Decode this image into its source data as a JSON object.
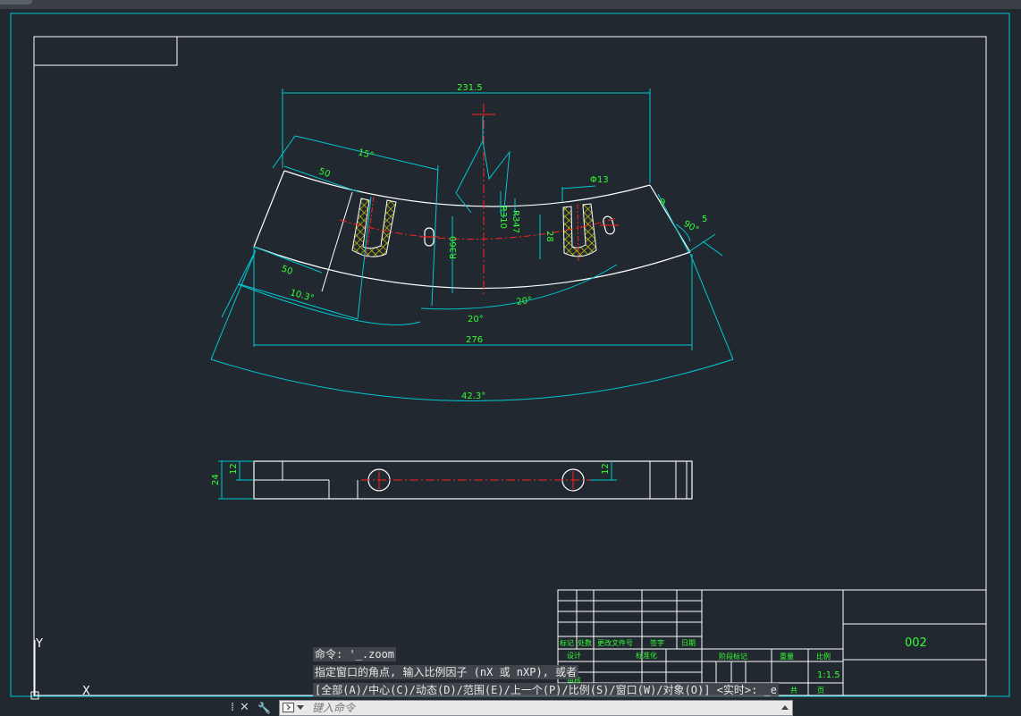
{
  "drawing": {
    "dim_overall_width": "231.5",
    "dim_angle_15": "15°",
    "dim_50_top": "50",
    "dim_50_left": "50",
    "dim_angle_10_3": "10.3°",
    "dim_angle_20_a": "20°",
    "dim_angle_20_b": "20°",
    "dim_276": "276",
    "dim_angle_42_3": "42.3°",
    "dim_r310": "R310",
    "dim_r347": "R347",
    "dim_r360": "R360",
    "dim_phi13": "Φ13",
    "dim_28": "28",
    "dim_9": "9",
    "dim_90deg": "90°",
    "dim_5": "5",
    "dim_24": "24",
    "dim_12_left": "12",
    "dim_12_right": "12"
  },
  "title_block": {
    "drawing_no": "002",
    "scale": "1:1.5",
    "header_row": [
      "标记",
      "处数",
      "更改文件号",
      "签字",
      "日期"
    ],
    "design": "设计",
    "standardize": "标准化",
    "review": "审核",
    "stage_mark": "阶段标记",
    "weight": "重量",
    "ratio": "比例",
    "total": "共",
    "page": "页"
  },
  "ucs": {
    "y_label": "Y",
    "x_label": "X"
  },
  "command": {
    "history": [
      "命令: '_.zoom",
      "指定窗口的角点, 输入比例因子 (nX 或 nXP), 或者",
      "[全部(A)/中心(C)/动态(D)/范围(E)/上一个(P)/比例(S)/窗口(W)/对象(O)] <实时>: _e"
    ],
    "placeholder": "键入命令",
    "close_glyph": "✕",
    "wrench_glyph": "🔧",
    "grip_glyph": "⁞"
  },
  "colors": {
    "background": "#212830",
    "cyan": "#00c8d2",
    "white": "#ffffff",
    "green": "#33ff33",
    "red": "#ff2020",
    "yellow": "#e6e600"
  }
}
